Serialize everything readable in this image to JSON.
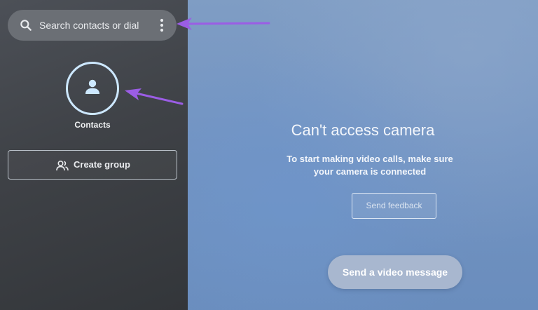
{
  "sidebar": {
    "search": {
      "placeholder": "Search contacts or dial",
      "icon": "search-icon",
      "menu_icon": "more-vert-icon"
    },
    "contacts": {
      "label": "Contacts",
      "icon": "person-icon"
    },
    "create_group": {
      "label": "Create group",
      "icon": "group-icon"
    }
  },
  "main": {
    "title": "Can't access camera",
    "subtitle": "To start making video calls, make sure your camera is connected",
    "feedback_button": "Send feedback",
    "video_message_button": "Send a video message"
  },
  "colors": {
    "annotation_arrow": "#9b5de5",
    "sidebar_bg": "#3f4247",
    "main_bg": "#7394c2",
    "accent_ring": "#cde8ff"
  }
}
